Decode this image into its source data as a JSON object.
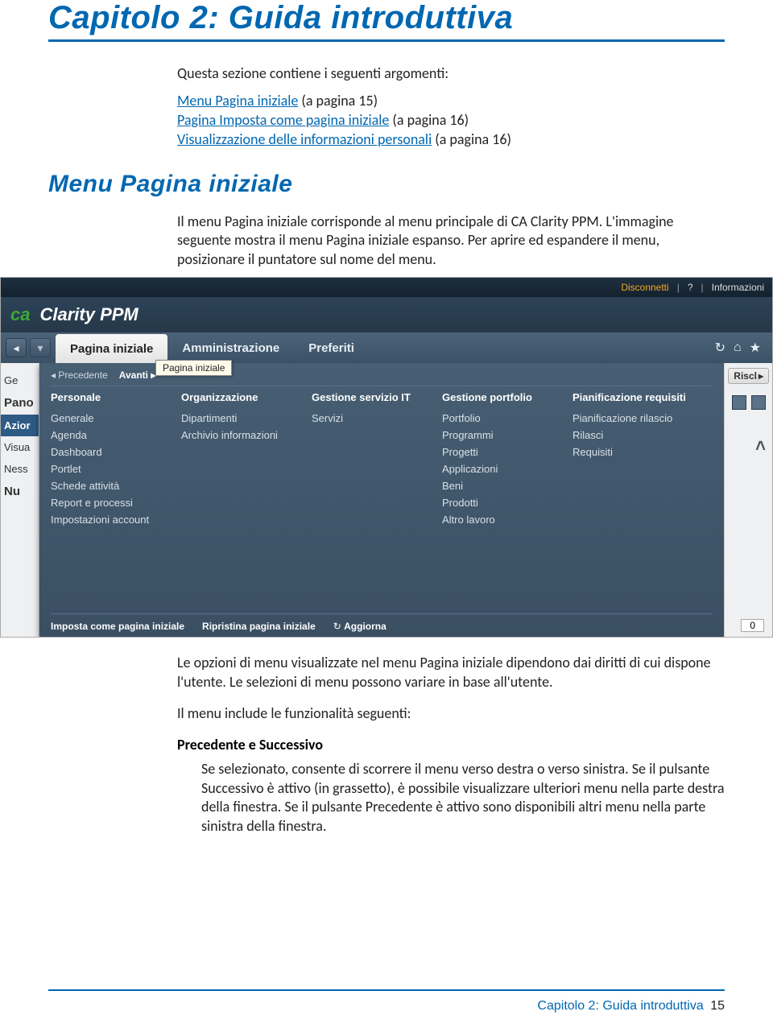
{
  "chapter_title": "Capitolo 2: Guida introduttiva",
  "intro": "Questa sezione contiene i seguenti argomenti:",
  "toc": [
    {
      "label": "Menu Pagina iniziale",
      "suffix": " (a pagina 15)"
    },
    {
      "label": "Pagina Imposta come pagina iniziale",
      "suffix": " (a pagina 16)"
    },
    {
      "label": "Visualizzazione delle informazioni personali",
      "suffix": " (a pagina 16)"
    }
  ],
  "section_title": "Menu Pagina iniziale",
  "body1": "Il menu Pagina iniziale corrisponde al menu principale di CA Clarity PPM. L'immagine seguente mostra il menu Pagina iniziale espanso. Per aprire ed espandere il menu, posizionare il puntatore sul nome del menu.",
  "screenshot": {
    "topbar": {
      "disconnetti": "Disconnetti",
      "help": "?",
      "informazioni": "Informazioni"
    },
    "brand": {
      "logo": "ca",
      "product": "Clarity PPM"
    },
    "tabs": {
      "home": "Pagina iniziale",
      "admin": "Amministrazione",
      "fav": "Preferiti"
    },
    "tooltip": "Pagina iniziale",
    "nav_icons": {
      "refresh": "↻",
      "home": "⌂",
      "star": "★"
    },
    "left_rows": {
      "ge": "Ge",
      "pano": "Pano",
      "azior": "Azior",
      "visua": "Visua",
      "ness": "Ness",
      "nu": "Nu"
    },
    "right": {
      "risc": "Riscl",
      "count": "0"
    },
    "mega": {
      "prev": "Precedente",
      "next": "Avanti",
      "cols": [
        {
          "head": "Personale",
          "items": [
            "Generale",
            "Agenda",
            "Dashboard",
            "Portlet",
            "Schede attività",
            "Report e processi",
            "Impostazioni account"
          ]
        },
        {
          "head": "Organizzazione",
          "items": [
            "Dipartimenti",
            "Archivio informazioni"
          ]
        },
        {
          "head": "Gestione servizio IT",
          "items": [
            "Servizi"
          ]
        },
        {
          "head": "Gestione portfolio",
          "items": [
            "Portfolio",
            "Programmi",
            "Progetti",
            "Applicazioni",
            "Beni",
            "Prodotti",
            "Altro lavoro"
          ]
        },
        {
          "head": "Pianificazione requisiti",
          "items": [
            "Pianificazione rilascio",
            "Rilasci",
            "Requisiti"
          ]
        }
      ],
      "footer": {
        "set_home": "Imposta come pagina iniziale",
        "reset_home": "Ripristina pagina iniziale",
        "refresh": "Aggiorna"
      }
    }
  },
  "body2": "Le opzioni di menu visualizzate nel menu Pagina iniziale dipendono dai diritti di cui dispone l'utente. Le selezioni di menu possono variare in base all'utente.",
  "body3": "Il menu include le funzionalità seguenti:",
  "sub_head": "Precedente e Successivo",
  "sub_body": "Se selezionato, consente di scorrere il menu verso destra o verso sinistra. Se il pulsante Successivo è attivo (in grassetto), è possibile visualizzare ulteriori menu nella parte destra della finestra. Se il pulsante Precedente è attivo sono disponibili altri menu nella parte sinistra della finestra.",
  "footer": {
    "label": "Capitolo 2: Guida introduttiva",
    "page": "15"
  }
}
